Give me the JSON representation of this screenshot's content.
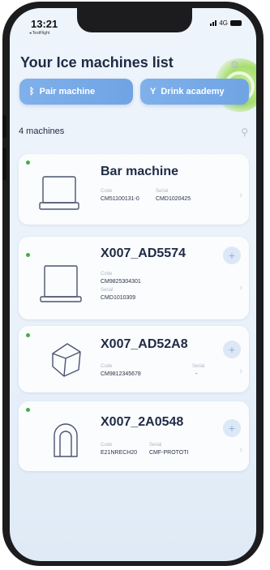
{
  "status_bar": {
    "time": "13:21",
    "sub": "◂ TestFlight",
    "network": "4G"
  },
  "header": {
    "title": "Your Ice machines list"
  },
  "actions": {
    "pair_label": "Pair machine",
    "drink_label": "Drink academy"
  },
  "list": {
    "count_label": "4 machines"
  },
  "machines": [
    {
      "name": "Bar machine",
      "code_label": "Code",
      "code": "CM51100131-0",
      "serial_label": "Serial",
      "serial": "CMD1020425",
      "icon": "bar-machine-icon",
      "status_color": "#3fb044"
    },
    {
      "name": "X007_AD5574",
      "code_label": "Code",
      "code": "CM9825304301",
      "serial_label": "Serial",
      "serial": "CMD1010309",
      "icon": "cube-machine-icon",
      "status_color": "#3fb044"
    },
    {
      "name": "X007_AD52A8",
      "code_label": "Code",
      "code": "CM9812345678",
      "serial_label": "Serial",
      "serial": "-",
      "icon": "ice-cube-icon",
      "status_color": "#3fb044"
    },
    {
      "name": "X007_2A0548",
      "code_label": "Code",
      "code": "E21NRECH20",
      "serial_label": "Serial",
      "serial": "CMF-PROTOTI",
      "icon": "arch-machine-icon",
      "status_color": "#3fb044"
    }
  ],
  "colors": {
    "accent": "#6fa4e4",
    "title": "#1f2a44",
    "status_online": "#3fb044"
  }
}
